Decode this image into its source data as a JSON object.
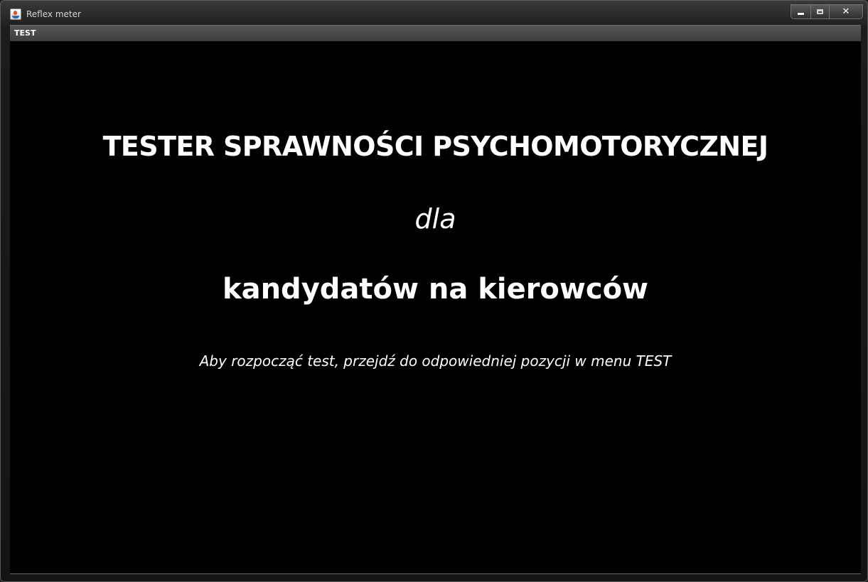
{
  "window": {
    "title": "Reflex meter",
    "icon": "java-app-icon",
    "controls": {
      "minimize_icon": "minimize-icon",
      "maximize_icon": "maximize-icon",
      "close_label": "✕"
    }
  },
  "menubar": {
    "items": [
      {
        "label": "TEST"
      }
    ]
  },
  "content": {
    "heading": "TESTER SPRAWNOŚCI PSYCHOMOTORYCZNEJ",
    "subheading": "dla",
    "target_group": "kandydatów na kierowców",
    "instruction": "Aby rozpocząć test, przejdź do odpowiedniej pozycji w menu TEST"
  },
  "colors": {
    "background": "#000000",
    "text": "#ffffff",
    "chrome": "#2a2a2a"
  }
}
